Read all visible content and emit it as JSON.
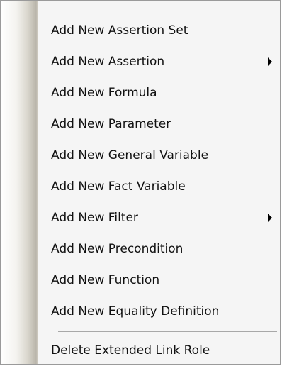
{
  "menu": {
    "items": [
      {
        "label": "Add New Assertion Set",
        "submenu": false
      },
      {
        "label": "Add New Assertion",
        "submenu": true
      },
      {
        "label": "Add New Formula",
        "submenu": false
      },
      {
        "label": "Add New Parameter",
        "submenu": false
      },
      {
        "label": "Add New General Variable",
        "submenu": false
      },
      {
        "label": "Add New Fact Variable",
        "submenu": false
      },
      {
        "label": "Add New Filter",
        "submenu": true
      },
      {
        "label": "Add New Precondition",
        "submenu": false
      },
      {
        "label": "Add New Function",
        "submenu": false
      },
      {
        "label": "Add New Equality Definition",
        "submenu": false
      }
    ],
    "footer_item": {
      "label": "Delete Extended Link Role"
    }
  }
}
